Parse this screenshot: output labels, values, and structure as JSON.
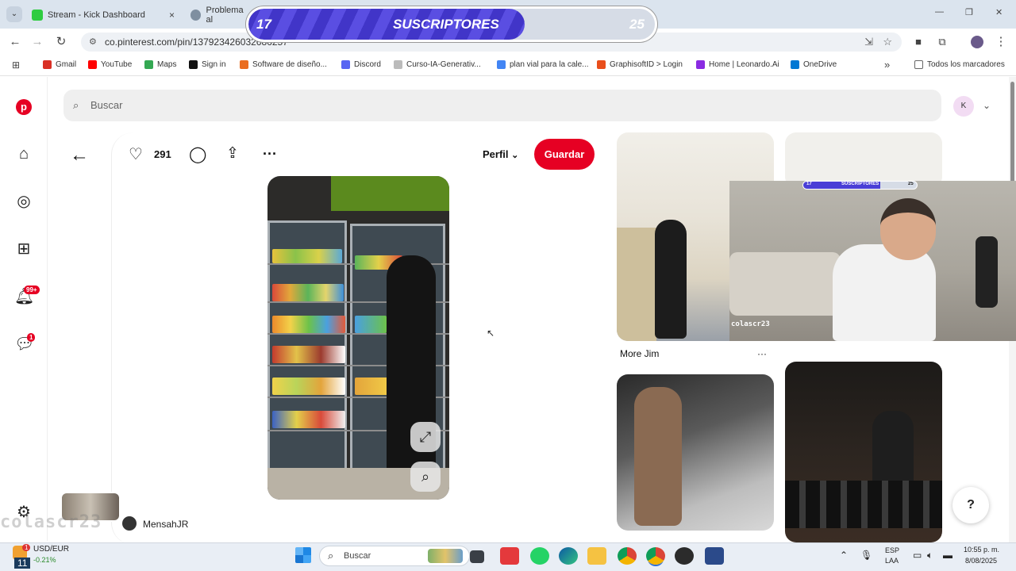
{
  "browser": {
    "tabs": [
      {
        "label": "Stream - Kick Dashboard",
        "close": "×"
      },
      {
        "label": "Problema al",
        "close": ""
      }
    ],
    "url": "co.pinterest.com/pin/137923426032686257",
    "window_controls": [
      "—",
      "❐",
      "✕"
    ],
    "bookmarks": [
      {
        "label": "Gmail",
        "color": "#d93025"
      },
      {
        "label": "YouTube",
        "color": "#ff0000"
      },
      {
        "label": "Maps",
        "color": "#34a853"
      },
      {
        "label": "Sign in",
        "color": "#111111"
      },
      {
        "label": "Software de diseño...",
        "color": "#ea6d20"
      },
      {
        "label": "Discord",
        "color": "#5865f2"
      },
      {
        "label": "Curso-IA-Generativ...",
        "color": "#bbbbbb"
      },
      {
        "label": "plan vial para la cale...",
        "color": "#4285f4"
      },
      {
        "label": "GraphisoftID > Login",
        "color": "#e94e1b"
      },
      {
        "label": "Home | Leonardo.Ai",
        "color": "#8a2be2"
      },
      {
        "label": "OneDrive",
        "color": "#0078d4"
      }
    ],
    "all_bookmarks": "Todos los marcadores"
  },
  "overlay": {
    "current": "17",
    "label": "SUSCRIPTORES",
    "goal": "25",
    "progress": 0.68
  },
  "pinterest": {
    "search_placeholder": "Buscar",
    "avatar_letter": "K",
    "notifications_badge": "99+",
    "messages_badge": "1",
    "likes": "291",
    "profile_label": "Perfil",
    "save_label": "Guardar",
    "author": "MensahJR",
    "related": [
      {
        "caption": "More Jim",
        "more": "···"
      }
    ],
    "help": "?",
    "accent": "#e60023"
  },
  "webcam": {
    "mini_current": "17",
    "mini_label": "SUSCRIPTORES",
    "mini_goal": "25",
    "watermark": "colascr23"
  },
  "taskbar": {
    "search_placeholder": "Buscar",
    "widget_label": "USD/EUR",
    "widget_value": "-0.21%",
    "widget_badge": "1",
    "language_1": "ESP",
    "language_2": "LAA",
    "time": "10:55 p. m.",
    "date": "8/08/2025",
    "corner_number": "11"
  },
  "cursor_visible": true
}
